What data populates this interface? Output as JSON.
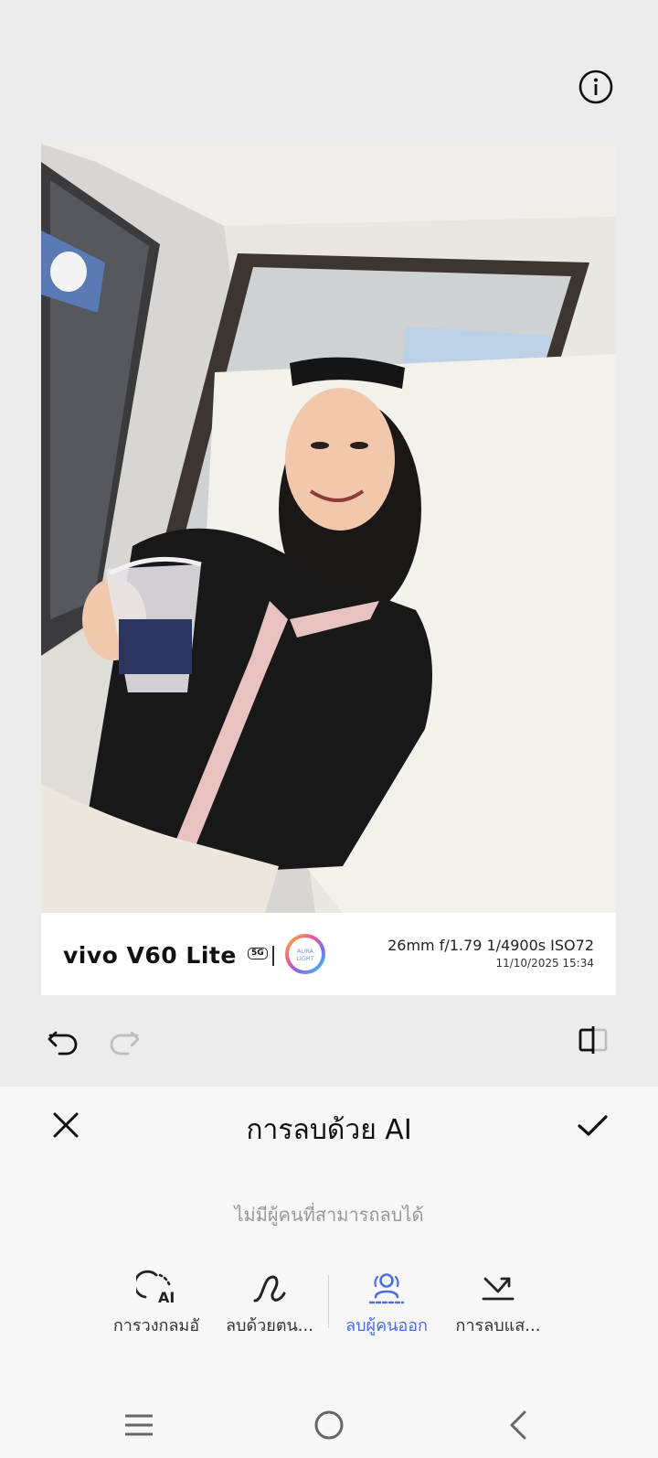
{
  "colors": {
    "accent": "#4b6fe0",
    "sheet_bg": "#f7f7f7",
    "page_bg": "#ececec"
  },
  "top_bar": {
    "info_icon": "info-circle-icon"
  },
  "photo": {
    "description_icon": "photo",
    "watermark": {
      "brand": "vivo V60 Lite",
      "network_badge": "5G",
      "logo_text_1": "AURA",
      "logo_text_2": "LIGHT",
      "exif": "26mm  f/1.79  1/4900s  ISO72",
      "datetime": "11/10/2025 15:34"
    }
  },
  "edit_bar": {
    "undo_icon": "undo-icon",
    "redo_icon": "redo-icon",
    "compare_icon": "compare-icon"
  },
  "sheet": {
    "title": "การลบด้วย AI",
    "hint": "ไม่มีผู้คนที่สามารถลบได้",
    "tools": [
      {
        "label": "การวงกลมอั",
        "icon": "ai-circle-icon",
        "active": false
      },
      {
        "label": "ลบด้วยตน...",
        "icon": "brush-stroke-icon",
        "active": false
      },
      {
        "label": "ลบผู้คนออก",
        "icon": "remove-people-icon",
        "active": true
      },
      {
        "label": "การลบแส...",
        "icon": "remove-reflection-icon",
        "active": false
      }
    ]
  },
  "nav_bar": {
    "menu_icon": "menu-icon",
    "home_icon": "home-icon",
    "back_icon": "back-icon"
  }
}
